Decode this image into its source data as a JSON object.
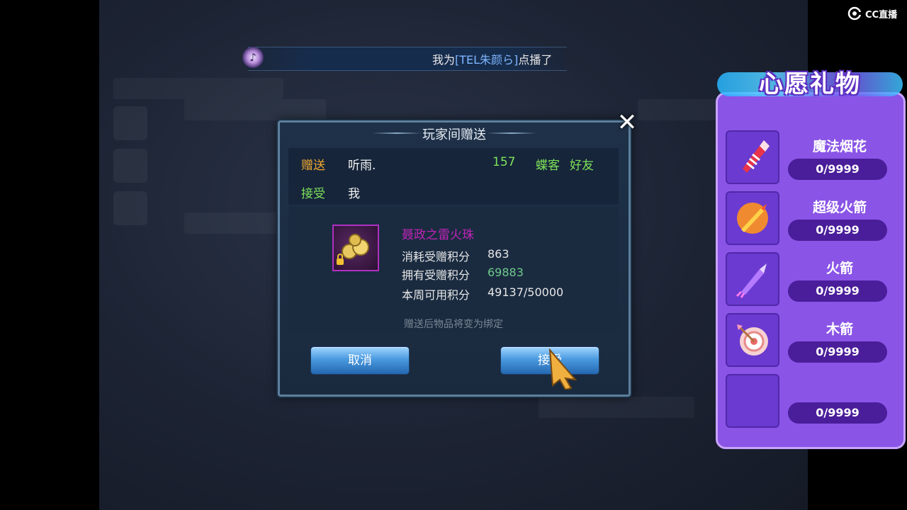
{
  "logo": {
    "text": "CC直播"
  },
  "broadcast": {
    "prefix": "我为",
    "tag": "[TEL朱颜ら]",
    "suffix": "点播了"
  },
  "dialog": {
    "title": "玩家间赠送",
    "sender_label": "赠送",
    "sender_name": "听雨.",
    "sender_level": "157",
    "sender_class": "蝶客",
    "sender_relation": "好友",
    "receiver_label": "接受",
    "receiver_name": "我",
    "item_name": "聂政之雷火珠",
    "stats": [
      {
        "label": "消耗受赠积分",
        "value": "863"
      },
      {
        "label": "拥有受赠积分",
        "value": "69883"
      },
      {
        "label": "本周可用积分",
        "value": "49137/50000"
      }
    ],
    "hint": "赠送后物品将变为绑定",
    "cancel_label": "取消",
    "accept_label": "接受",
    "close_glyph": "✕"
  },
  "wish": {
    "title": "心愿礼物",
    "gifts": [
      {
        "name": "魔法烟花",
        "count": "0/9999",
        "icon": "firework-icon"
      },
      {
        "name": "超级火箭",
        "count": "0/9999",
        "icon": "super-rocket-icon"
      },
      {
        "name": "火箭",
        "count": "0/9999",
        "icon": "rocket-icon"
      },
      {
        "name": "木箭",
        "count": "0/9999",
        "icon": "wood-arrow-icon"
      },
      {
        "name": "",
        "count": "0/9999",
        "icon": "empty-slot"
      }
    ]
  },
  "colors": {
    "wish_panel": "#8a54e6",
    "item_name": "#c024b8",
    "label_orange": "#f0a830",
    "label_green": "#7ee25a"
  }
}
